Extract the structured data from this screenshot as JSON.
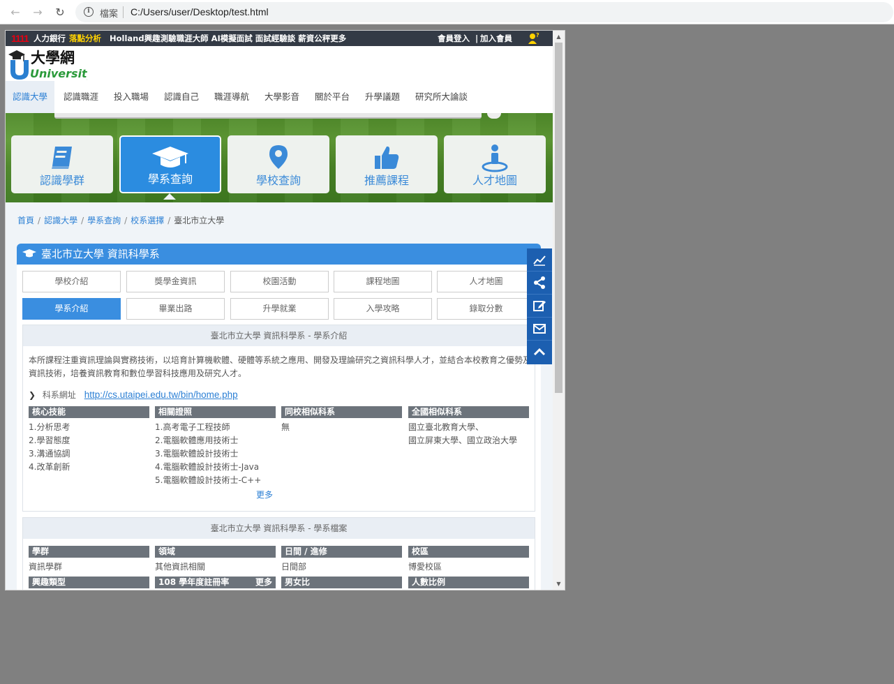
{
  "browser": {
    "address_label": "檔案",
    "url": "C:/Users/user/Desktop/test.html"
  },
  "topbar": {
    "logo": "1111",
    "bank": "人力銀行",
    "highlight": "落點分析",
    "links": "Holland興趣測驗職涯大師 AI模擬面試 面試經驗談 薪資公秤更多",
    "login": "會員登入",
    "divider": "|",
    "join": "加入會員"
  },
  "logo": {
    "cn": "大學網",
    "en": "University"
  },
  "menu": [
    "認識大學",
    "認識職涯",
    "投入職場",
    "認識自己",
    "職涯導航",
    "大學影音",
    "關於平台",
    "升學議題",
    "研究所大論談"
  ],
  "categories": [
    "認識學群",
    "學系查詢",
    "學校查詢",
    "推薦課程",
    "人才地圖"
  ],
  "breadcrumb": [
    "首頁",
    "認識大學",
    "學系查詢",
    "校系選擇",
    "臺北市立大學"
  ],
  "panel": {
    "title": "臺北市立大學 資訊科學系",
    "tabs_row1": [
      "學校介紹",
      "獎學金資訊",
      "校園活動",
      "課程地圖",
      "人才地圖"
    ],
    "tabs_row2": [
      "學系介紹",
      "畢業出路",
      "升學就業",
      "入學攻略",
      "錄取分數"
    ]
  },
  "intro": {
    "heading": "臺北市立大學 資訊科學系 - 學系介紹",
    "text": "本所課程注重資訊理論與實務技術，以培育計算機軟體、硬體等系統之應用、開發及理論研究之資訊科學人才，並結合本校教育之優勢及資訊技術，培養資訊教育和數位學習科技應用及研究人才。",
    "url_label": "科系網址",
    "url": "http://cs.utaipei.edu.tw/bin/home.php",
    "columns": [
      {
        "title": "核心技能",
        "items": [
          "1.分析思考",
          "2.學習態度",
          "3.溝通協調",
          "4.改革創新"
        ]
      },
      {
        "title": "相關證照",
        "items": [
          "1.高考電子工程技師",
          "2.電腦軟體應用技術士",
          "3.電腦軟體設計技術士",
          "4.電腦軟體設計技術士-Java",
          "5.電腦軟體設計技術士-C++"
        ]
      },
      {
        "title": "同校相似科系",
        "items": [
          "無"
        ]
      },
      {
        "title": "全國相似科系",
        "items": [
          "國立臺北教育大學、",
          "國立屏東大學、國立政治大學"
        ]
      }
    ],
    "more": "更多"
  },
  "profile": {
    "heading": "臺北市立大學 資訊科學系 - 學系檔案",
    "row1": [
      {
        "title": "學群",
        "value": "資訊學群"
      },
      {
        "title": "領域",
        "value": "其他資訊相關"
      },
      {
        "title": "日間 / 進修",
        "value": "日間部"
      },
      {
        "title": "校區",
        "value": "博愛校區"
      }
    ],
    "row2": [
      {
        "title": "興趣類型"
      },
      {
        "title": "108 學年度註冊率",
        "more": "更多"
      },
      {
        "title": "男女比"
      },
      {
        "title": "人數比例"
      }
    ]
  },
  "side_tools": [
    "chart-icon",
    "share-icon",
    "edit-icon",
    "mail-icon",
    "chevron-up-icon"
  ],
  "colors": {
    "accent": "#3a8ee0",
    "topbar": "#333a45",
    "grass": "#4f8a2a",
    "side": "#1c5fb0"
  }
}
